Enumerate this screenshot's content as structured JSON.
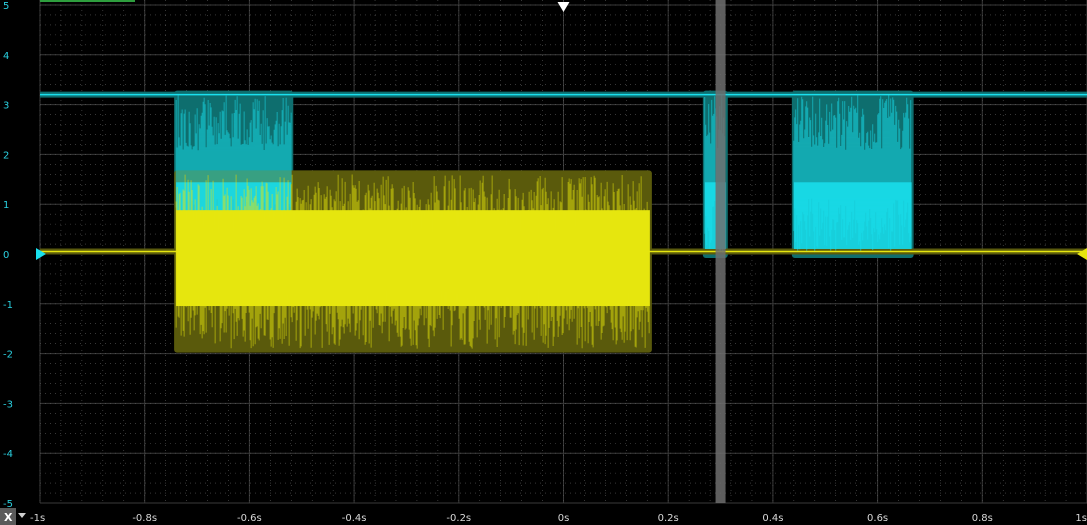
{
  "y_axis": {
    "labels": [
      "5",
      "4",
      "3",
      "2",
      "1",
      "0",
      "-1",
      "-2",
      "-3",
      "-4",
      "-5"
    ],
    "values": [
      5,
      4,
      3,
      2,
      1,
      0,
      -1,
      -2,
      -3,
      -4,
      -5
    ],
    "label_color": "#2ad0e0"
  },
  "x_axis": {
    "labels": [
      "-1s",
      "-0.8s",
      "-0.6s",
      "-0.4s",
      "-0.2s",
      "0s",
      "0.2s",
      "0.4s",
      "0.6s",
      "0.8s",
      "1s"
    ],
    "values": [
      -1,
      -0.8,
      -0.6,
      -0.4,
      -0.2,
      0,
      0.2,
      0.4,
      0.6,
      0.8,
      1
    ],
    "range": [
      -1,
      1
    ],
    "label_color": "#d8d8d8"
  },
  "toolbar": {
    "x_button_label": "X"
  },
  "colors": {
    "background": "#000000",
    "grid_major": "#3a3a3a",
    "grid_dot": "#5a5a5a",
    "cyan": "#19e0ee",
    "cyan_envelope": "#0e6e6e",
    "yellow": "#e6e60f",
    "yellow_envelope": "#5a5a0c",
    "cursor": "#6e6e6e",
    "trigger": "#ffffff",
    "top_strip": "#2e9e3e"
  },
  "markers": {
    "trigger_x": 0,
    "cursor_x": 0.3,
    "cyan_ground_ref_y": 0,
    "yellow_ground_ref_y": 0
  },
  "chart_data": {
    "type": "line",
    "xlabel": "",
    "ylabel": "",
    "xlim": [
      -1,
      1
    ],
    "ylim": [
      -5,
      5
    ],
    "grid": true,
    "series": [
      {
        "color": "#19e0ee",
        "idle_level": 3.2,
        "bursts": [
          {
            "start": -0.74,
            "end": -0.52,
            "min": 0.0,
            "max": 3.2
          },
          {
            "start": 0.27,
            "end": 0.31,
            "min": 0.0,
            "max": 3.2
          },
          {
            "start": 0.44,
            "end": 0.665,
            "min": 0.0,
            "max": 3.2
          }
        ]
      },
      {
        "color": "#e6e60f",
        "idle_level": 0.05,
        "bursts": [
          {
            "start": -0.74,
            "end": 0.165,
            "min": -1.9,
            "max": 1.6
          }
        ]
      }
    ]
  }
}
